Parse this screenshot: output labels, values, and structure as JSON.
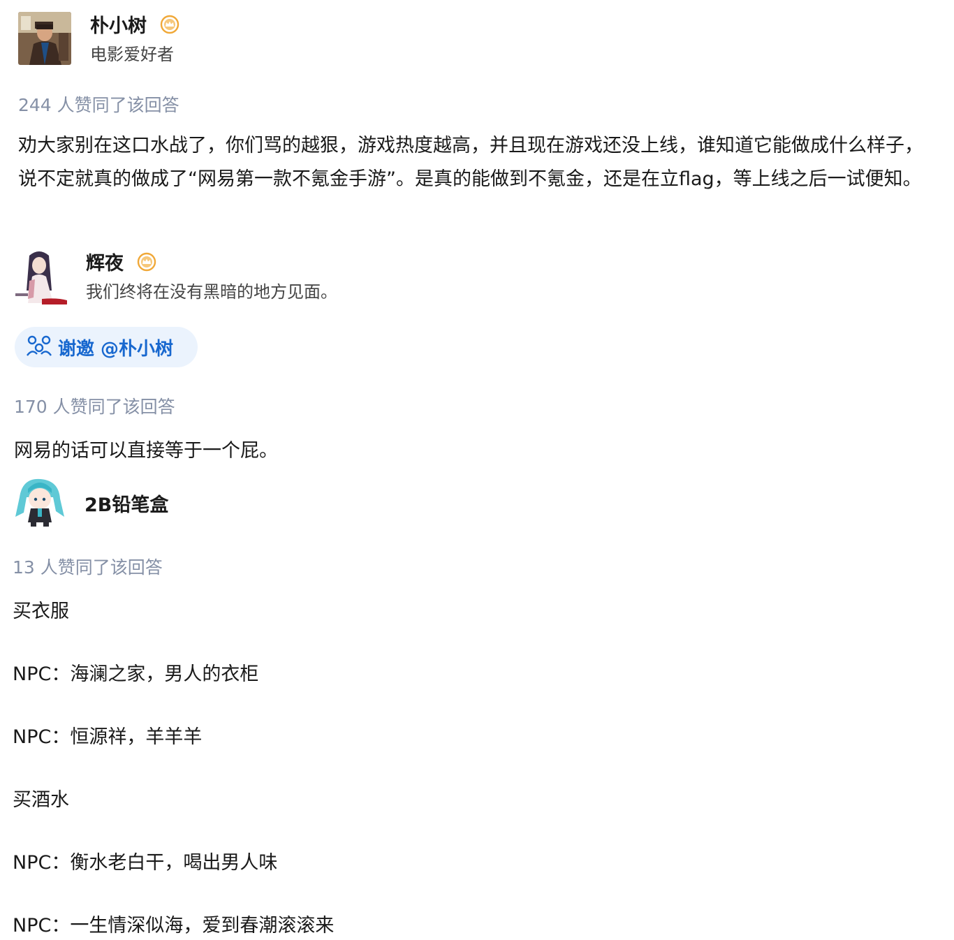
{
  "answers": [
    {
      "author": {
        "name": "朴小树",
        "bio": "电影爱好者"
      },
      "votes": "244 人赞同了该回答",
      "paragraph": "劝大家别在这口水战了，你们骂的越狠，游戏热度越高，并且现在游戏还没上线，谁知道它能做成什么样子，说不定就真的做成了“网易第一款不氪金手游”。是真的能做到不氪金，还是在立flag，等上线之后一试便知。"
    },
    {
      "author": {
        "name": "辉夜",
        "bio": "我们终将在没有黑暗的地方见面。"
      },
      "invite_label": "谢邀 @朴小树",
      "votes": "170 人赞同了该回答",
      "paragraph": "网易的话可以直接等于一个屁。"
    },
    {
      "author": {
        "name": "2B铅笔盒"
      },
      "votes": "13 人赞同了该回答",
      "lines": [
        "买衣服",
        "NPC：海澜之家，男人的衣柜",
        "NPC：恒源祥，羊羊羊",
        "买酒水",
        "NPC：衡水老白干，喝出男人味",
        "NPC：一生情深似海，爱到春潮滚滚来"
      ]
    }
  ],
  "colors": {
    "vote_text": "#8590a6",
    "invite_text": "#1868cf",
    "invite_bg": "#ebf3fd",
    "badge": "#f0a838"
  },
  "icons": {
    "badge": "verified-badge-icon",
    "invite": "invite-people-icon"
  }
}
